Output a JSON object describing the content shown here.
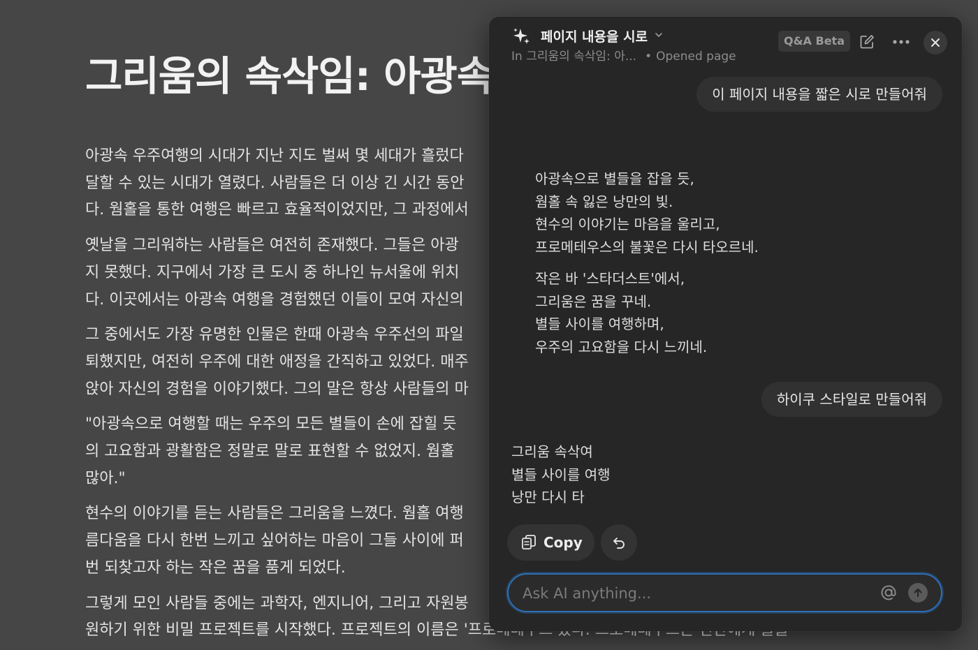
{
  "document": {
    "title": "그리움의 속삭임: 아광속",
    "paragraphs": [
      [
        "아광속 우주여행의 시대가 지난 지도 벌써 몇 세대가 흘렀다",
        "달할 수 있는 시대가 열렸다. 사람들은 더 이상 긴 시간 동안",
        "다. 웜홀을 통한 여행은 빠르고 효율적이었지만, 그 과정에서"
      ],
      [
        "옛날을 그리워하는 사람들은 여전히 존재했다. 그들은 아광",
        "지 못했다. 지구에서 가장 큰 도시 중 하나인 뉴서울에 위치",
        "다. 이곳에서는 아광속 여행을 경험했던 이들이 모여 자신의"
      ],
      [
        "그 중에서도 가장 유명한 인물은 한때 아광속 우주선의 파일",
        "퇴했지만, 여전히 우주에 대한 애정을 간직하고 있었다. 매주",
        "앉아 자신의 경험을 이야기했다. 그의 말은 항상 사람들의 마"
      ],
      [
        "\"아광속으로 여행할 때는 우주의 모든 별들이 손에 잡힐 듯",
        "의 고요함과 광활함은 정말로 말로 표현할 수 없었지. 웜홀",
        "많아.\""
      ],
      [
        "현수의 이야기를 듣는 사람들은 그리움을 느꼈다. 웜홀 여행",
        "름다움을 다시 한번 느끼고 싶어하는 마음이 그들 사이에 퍼",
        "번 되찾고자 하는 작은 꿈을 품게 되었다."
      ],
      [
        "그렇게 모인 사람들 중에는 과학자, 엔지니어, 그리고 자원봉",
        "원하기 위한 비밀 프로젝트를 시작했다. 프로젝트의 이름은 '프로메테우스'였다. 프로메테우스는 인간에게 불을"
      ]
    ]
  },
  "panel": {
    "title": "페이지 내용을 시로",
    "context": "In 그리움의 속삭임: 아...",
    "separator": "•",
    "context_status": "Opened page",
    "badge": "Q&A Beta",
    "messages": {
      "user_1": "이 페이지 내용을 짧은 시로 만들어줘",
      "poem_stanza_1": [
        "아광속으로 별들을 잡을 듯,",
        "웜홀 속 잃은 낭만의 빛.",
        "현수의 이야기는 마음을 울리고,",
        "프로메테우스의 불꽃은 다시 타오르네."
      ],
      "poem_stanza_2": [
        "작은 바 '스타더스트'에서,",
        "그리움은 꿈을 꾸네.",
        "별들 사이를 여행하며,",
        "우주의 고요함을 다시 느끼네."
      ],
      "user_2": "하이쿠 스타일로 만들어줘",
      "haiku": [
        "그리움 속삭여",
        "별들 사이를 여행",
        "낭만 다시 타"
      ]
    },
    "copy_label": "Copy",
    "input": {
      "placeholder": "Ask AI anything...",
      "value": ""
    }
  },
  "colors": {
    "page_background": "#464646",
    "panel_background": "#262626",
    "input_focus_border": "#2d6fb6"
  },
  "icons": [
    "sparkle-icon",
    "chevron-down-icon",
    "new-chat-icon",
    "more-icon",
    "close-icon",
    "copy-icon",
    "undo-icon",
    "at-icon",
    "send-arrow-icon"
  ]
}
